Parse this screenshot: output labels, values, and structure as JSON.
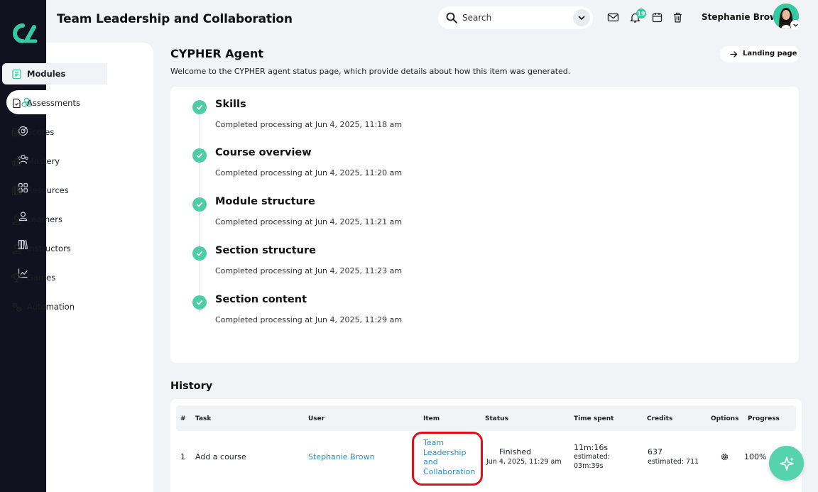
{
  "header": {
    "title": "Team Leadership and Collaboration",
    "search_placeholder": "Search",
    "notification_count": "19",
    "user_name": "Stephanie Brown"
  },
  "rail": {
    "items": [
      "home-icon",
      "modules-icon",
      "target-icon",
      "users-icon",
      "apps-icon",
      "user-icon",
      "books-icon",
      "chart-icon"
    ],
    "active_index": 1,
    "accent": "#34c9a0"
  },
  "subnav": {
    "items": [
      {
        "label": "Modules",
        "icon": "modules-doc-icon",
        "active": true
      },
      {
        "label": "Assessments",
        "icon": "assessment-icon",
        "active": false
      },
      {
        "label": "Scores",
        "icon": "table-icon",
        "active": false
      },
      {
        "label": "Mastery",
        "icon": "bar-chart-icon",
        "active": false
      },
      {
        "label": "Resources",
        "icon": "books-icon",
        "active": false
      },
      {
        "label": "Learners",
        "icon": "user-icon",
        "active": false
      },
      {
        "label": "Instructors",
        "icon": "instructor-icon",
        "active": false
      },
      {
        "label": "Games",
        "icon": "trophy-icon",
        "active": false
      },
      {
        "label": "Automation",
        "icon": "gears-icon",
        "active": false
      }
    ]
  },
  "agent": {
    "title": "CYPHER Agent",
    "description": "Welcome to the CYPHER agent status page, which provide details about how this item was generated.",
    "landing_label": "Landing page",
    "steps": [
      {
        "title": "Skills",
        "detail": "Completed processing at Jun 4, 2025, 11:18 am"
      },
      {
        "title": "Course overview",
        "detail": "Completed processing at Jun 4, 2025, 11:20 am"
      },
      {
        "title": "Module structure",
        "detail": "Completed processing at Jun 4, 2025, 11:21 am"
      },
      {
        "title": "Section structure",
        "detail": "Completed processing at Jun 4, 2025, 11:23 am"
      },
      {
        "title": "Section content",
        "detail": "Completed processing at Jun 4, 2025, 11:29 am"
      }
    ]
  },
  "history": {
    "title": "History",
    "columns": [
      "#",
      "Task",
      "User",
      "Item",
      "Status",
      "Time spent",
      "Credits",
      "Options",
      "Progress"
    ],
    "rows": [
      {
        "num": "1",
        "task": "Add a course",
        "user": "Stephanie Brown",
        "item": "Team Leadership and Collaboration",
        "status": "Finished",
        "status_date": "Jun 4, 2025, 11:29 am",
        "time_spent": "11m:16s",
        "time_estimated_label": "estimated:",
        "time_estimated": "03m:39s",
        "credits": "637",
        "credits_estimated": "estimated: 711",
        "progress": "100%"
      }
    ]
  }
}
